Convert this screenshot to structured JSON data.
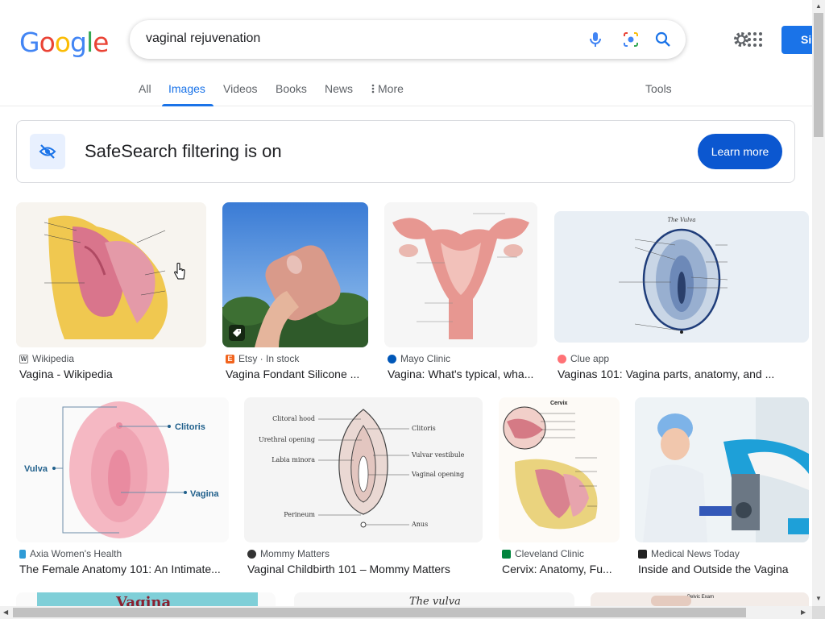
{
  "search": {
    "query": "vaginal rejuvenation"
  },
  "header": {
    "signin_label": "Si"
  },
  "tabs": [
    {
      "label": "All"
    },
    {
      "label": "Images"
    },
    {
      "label": "Videos"
    },
    {
      "label": "Books"
    },
    {
      "label": "News"
    },
    {
      "label": "More"
    }
  ],
  "tools_label": "Tools",
  "safesearch": {
    "text": "SafeSearch filtering is on",
    "button_label": "Learn more"
  },
  "results": [
    {
      "source": "Wikipedia",
      "title": "Vagina - Wikipedia",
      "favicon_color": "#ffffff"
    },
    {
      "source": "Etsy · In stock",
      "title": "Vagina Fondant Silicone ...",
      "favicon_color": "#f1641e"
    },
    {
      "source": "Mayo Clinic",
      "title": "Vagina: What's typical, wha...",
      "favicon_color": "#0057b8"
    },
    {
      "source": "Clue app",
      "title": "Vaginas 101: Vagina parts, anatomy, and ...",
      "favicon_color": "#ff7276"
    },
    {
      "source": "Axia Women's Health",
      "title": "The Female Anatomy 101: An Intimate...",
      "favicon_color": "#2e9bd6"
    },
    {
      "source": "Mommy Matters",
      "title": "Vaginal Childbirth 101 – Mommy Matters",
      "favicon_color": "#333333"
    },
    {
      "source": "Cleveland Clinic",
      "title": "Cervix: Anatomy, Fu...",
      "favicon_color": "#00843d"
    },
    {
      "source": "Medical News Today",
      "title": "Inside and Outside the Vagina",
      "favicon_color": "#222222"
    }
  ],
  "diagram_labels": {
    "vulva_title": "The Vulva",
    "clitoris": "Clitoris",
    "vulva": "Vulva",
    "vagina": "Vagina",
    "clitoral_hood": "Clitoral hood",
    "urethral_opening": "Urethral opening",
    "labia_minora": "Labia minora",
    "vulvar_vestibule": "Vulvar vestibule",
    "vaginal_opening": "Vaginal opening",
    "perineum": "Perineum",
    "anus": "Anus",
    "cervix": "Cervix",
    "row3_a": "Vagina",
    "row3_b": "The vulva",
    "row3_c": "Pelvic Exam"
  },
  "colors": {
    "accent": "#1a73e8",
    "learn_button": "#0b57d0",
    "tab_inactive": "#5f6368"
  }
}
